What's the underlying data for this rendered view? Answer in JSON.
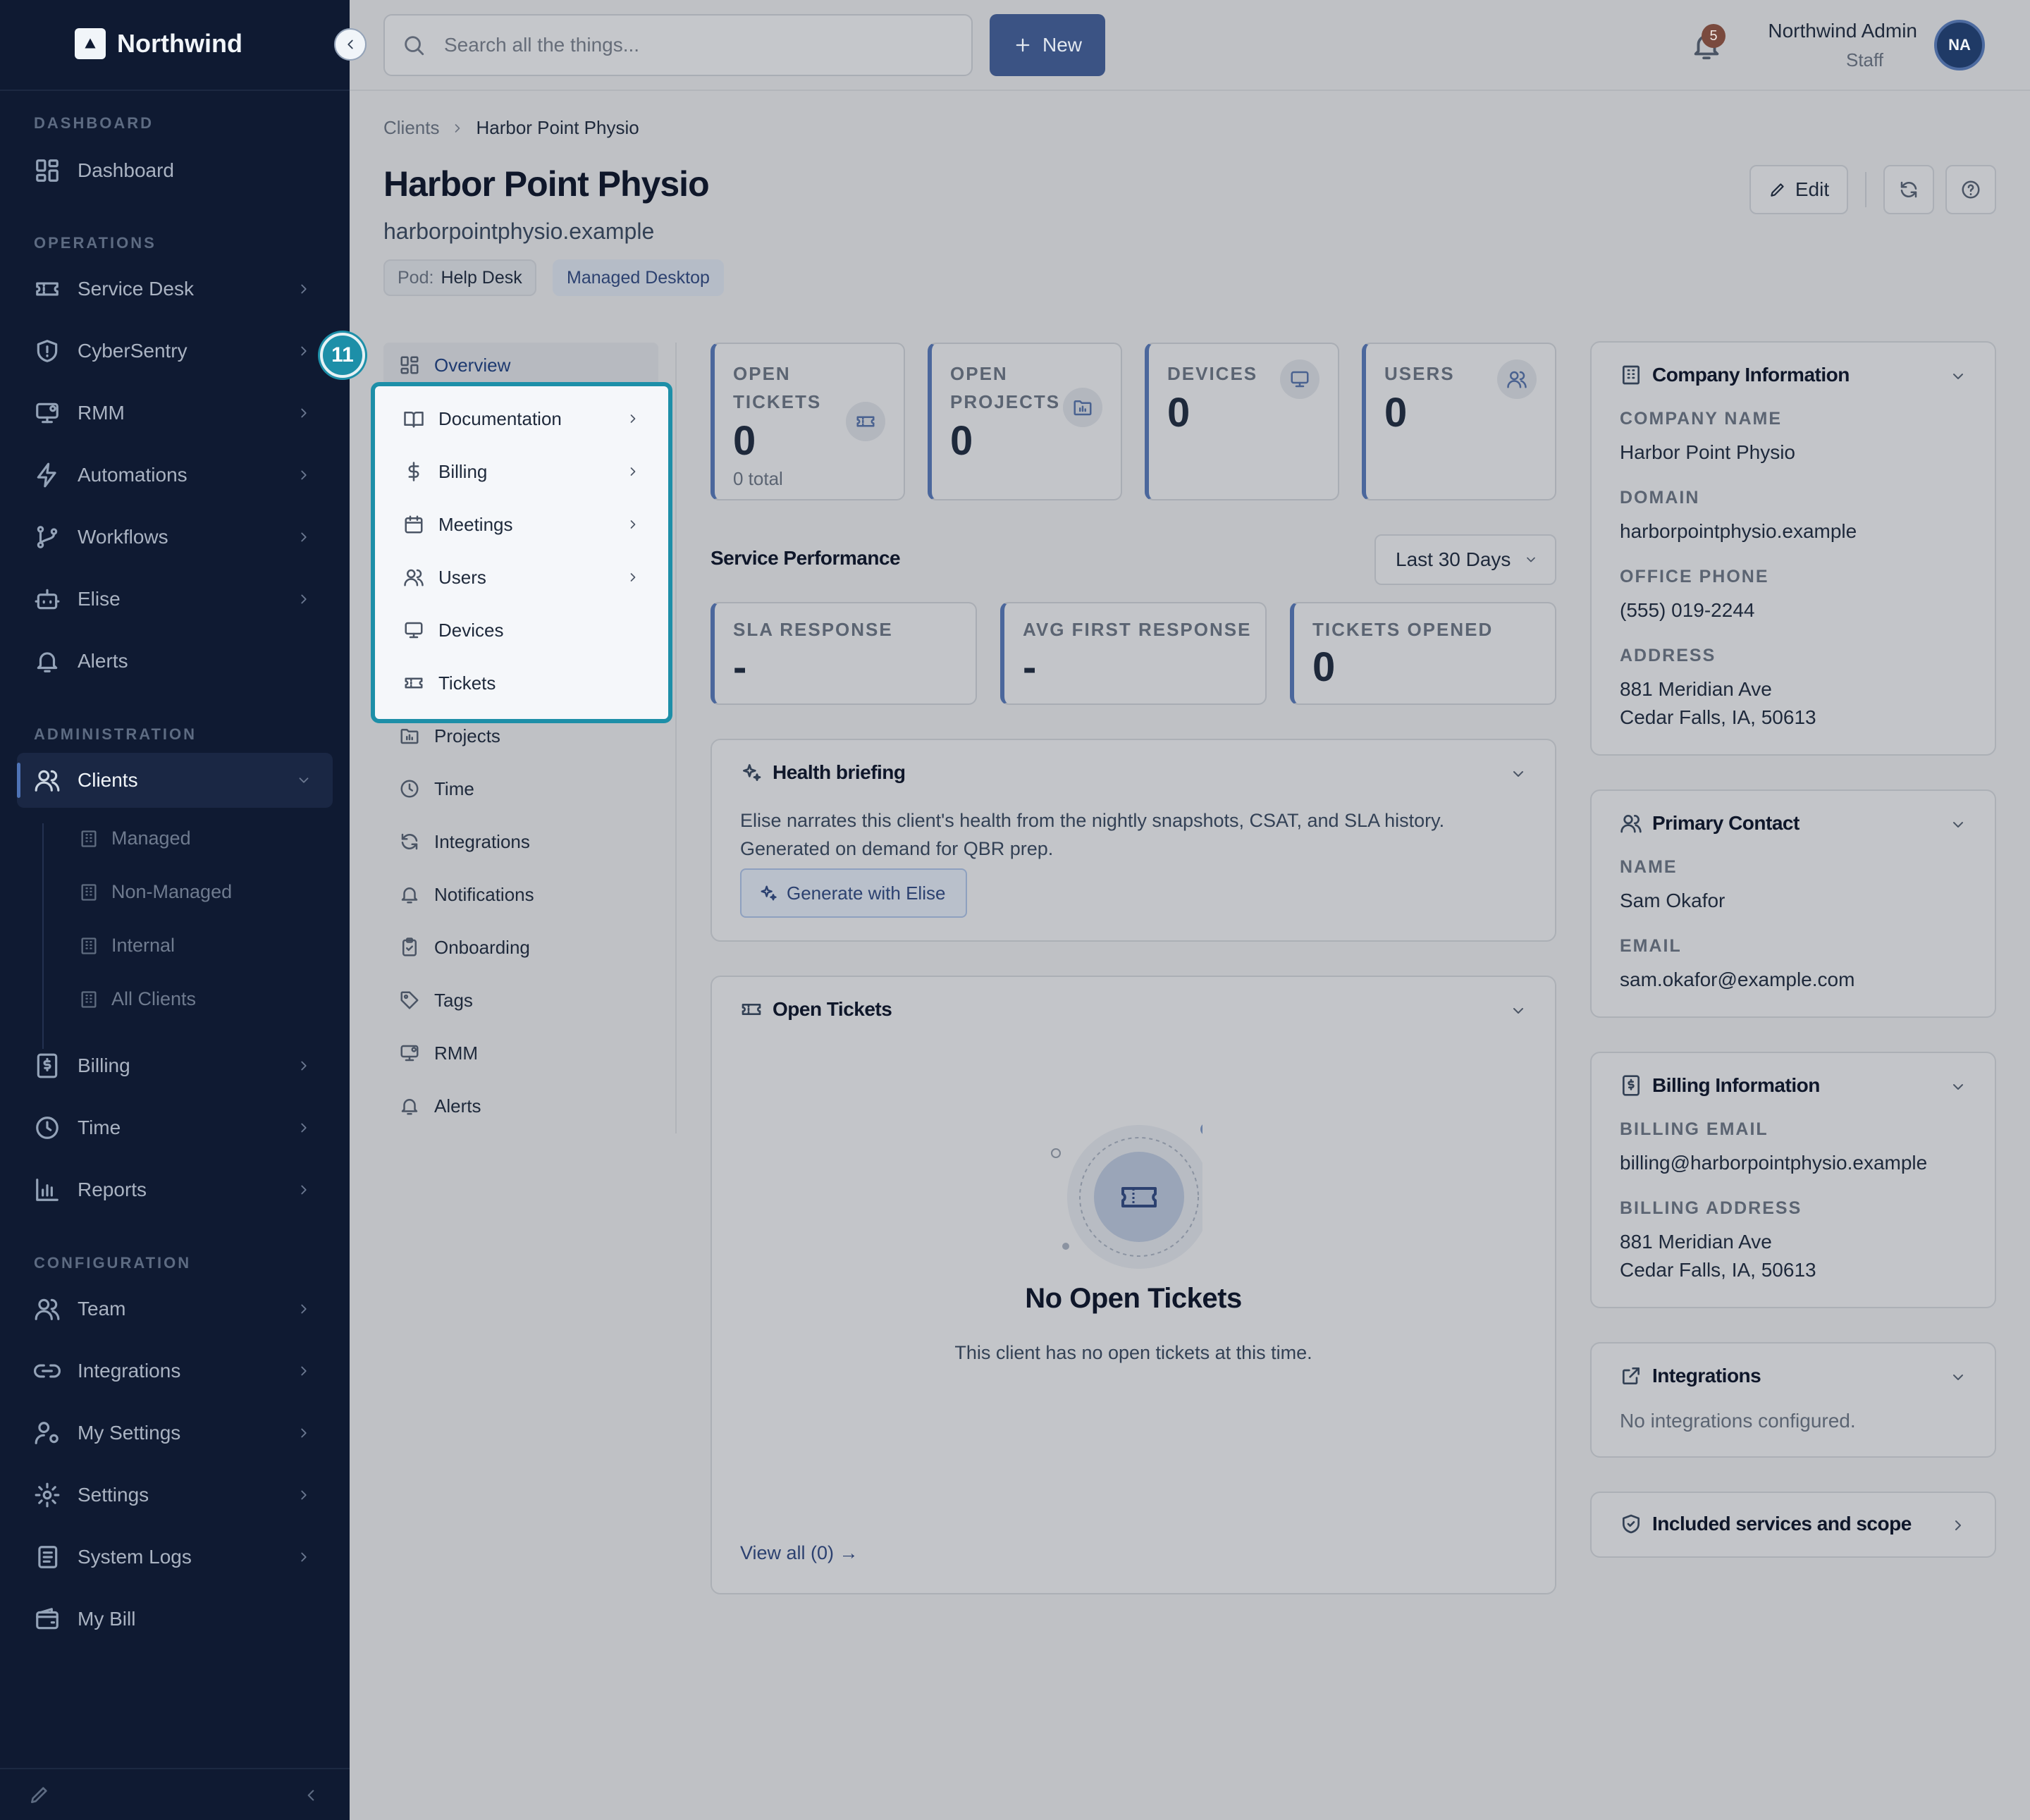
{
  "app": {
    "name": "Northwind"
  },
  "sidebar": {
    "sections": {
      "dashboard": "DASHBOARD",
      "operations": "OPERATIONS",
      "administration": "ADMINISTRATION",
      "configuration": "CONFIGURATION"
    },
    "items": {
      "dashboard": "Dashboard",
      "service_desk": "Service Desk",
      "cybersentry": "CyberSentry",
      "rmm": "RMM",
      "automations": "Automations",
      "workflows": "Workflows",
      "elise": "Elise",
      "alerts": "Alerts",
      "clients": "Clients",
      "billing": "Billing",
      "time": "Time",
      "reports": "Reports",
      "team": "Team",
      "integrations": "Integrations",
      "my_settings": "My Settings",
      "settings": "Settings",
      "system_logs": "System Logs",
      "my_bill": "My Bill"
    },
    "client_sub": {
      "managed": "Managed",
      "non_managed": "Non-Managed",
      "internal": "Internal",
      "all": "All Clients"
    }
  },
  "topbar": {
    "search_placeholder": "Search all the things...",
    "new_label": "New",
    "notification_count": "5",
    "user_name": "Northwind Admin",
    "user_role": "Staff",
    "user_initials": "NA"
  },
  "breadcrumb": {
    "parent": "Clients",
    "current": "Harbor Point Physio"
  },
  "client": {
    "name": "Harbor Point Physio",
    "domain": "harborpointphysio.example",
    "pod_label": "Pod:",
    "pod_value": "Help Desk",
    "plan_tag": "Managed Desktop",
    "edit_label": "Edit"
  },
  "subnav": {
    "overview": "Overview",
    "documentation": "Documentation",
    "billing": "Billing",
    "meetings": "Meetings",
    "users": "Users",
    "devices": "Devices",
    "tickets": "Tickets",
    "projects": "Projects",
    "time": "Time",
    "integrations": "Integrations",
    "notifications": "Notifications",
    "onboarding": "Onboarding",
    "tags": "Tags",
    "rmm": "RMM",
    "alerts": "Alerts"
  },
  "step_badge": "11",
  "stats": {
    "open_tickets": {
      "label": "OPEN TICKETS",
      "value": "0",
      "note": "0 total"
    },
    "open_projects": {
      "label": "OPEN PROJECTS",
      "value": "0"
    },
    "devices": {
      "label": "DEVICES",
      "value": "0"
    },
    "users": {
      "label": "USERS",
      "value": "0"
    }
  },
  "performance": {
    "title": "Service Performance",
    "range": "Last 30 Days",
    "sla": {
      "label": "SLA RESPONSE",
      "value": "-"
    },
    "avg_first": {
      "label": "AVG FIRST RESPONSE",
      "value": "-"
    },
    "opened": {
      "label": "TICKETS OPENED",
      "value": "0"
    }
  },
  "health": {
    "title": "Health briefing",
    "text": "Elise narrates this client's health from the nightly snapshots, CSAT, and SLA history. Generated on demand for QBR prep.",
    "button": "Generate with Elise"
  },
  "open_tickets": {
    "title": "Open Tickets",
    "empty_title": "No Open Tickets",
    "empty_text": "This client has no open tickets at this time.",
    "view_all": "View all (0) →"
  },
  "company_info": {
    "title": "Company Information",
    "company_name_label": "COMPANY NAME",
    "company_name": "Harbor Point Physio",
    "domain_label": "DOMAIN",
    "domain": "harborpointphysio.example",
    "phone_label": "OFFICE PHONE",
    "phone": "(555) 019-2244",
    "address_label": "ADDRESS",
    "address_line1": "881 Meridian Ave",
    "address_line2": "Cedar Falls, IA, 50613"
  },
  "primary_contact": {
    "title": "Primary Contact",
    "name_label": "NAME",
    "name": "Sam Okafor",
    "email_label": "EMAIL",
    "email": "sam.okafor@example.com"
  },
  "billing_info": {
    "title": "Billing Information",
    "email_label": "BILLING EMAIL",
    "email": "billing@harborpointphysio.example",
    "address_label": "BILLING ADDRESS",
    "address_line1": "881 Meridian Ave",
    "address_line2": "Cedar Falls, IA, 50613"
  },
  "integrations_card": {
    "title": "Integrations",
    "empty": "No integrations configured."
  },
  "included_services": {
    "title": "Included services and scope"
  },
  "colors": {
    "sidebar_bg": "#0f1a32",
    "accent": "#3b5384",
    "highlight": "#1d8fa8",
    "page_bg": "#bfc1c5"
  }
}
